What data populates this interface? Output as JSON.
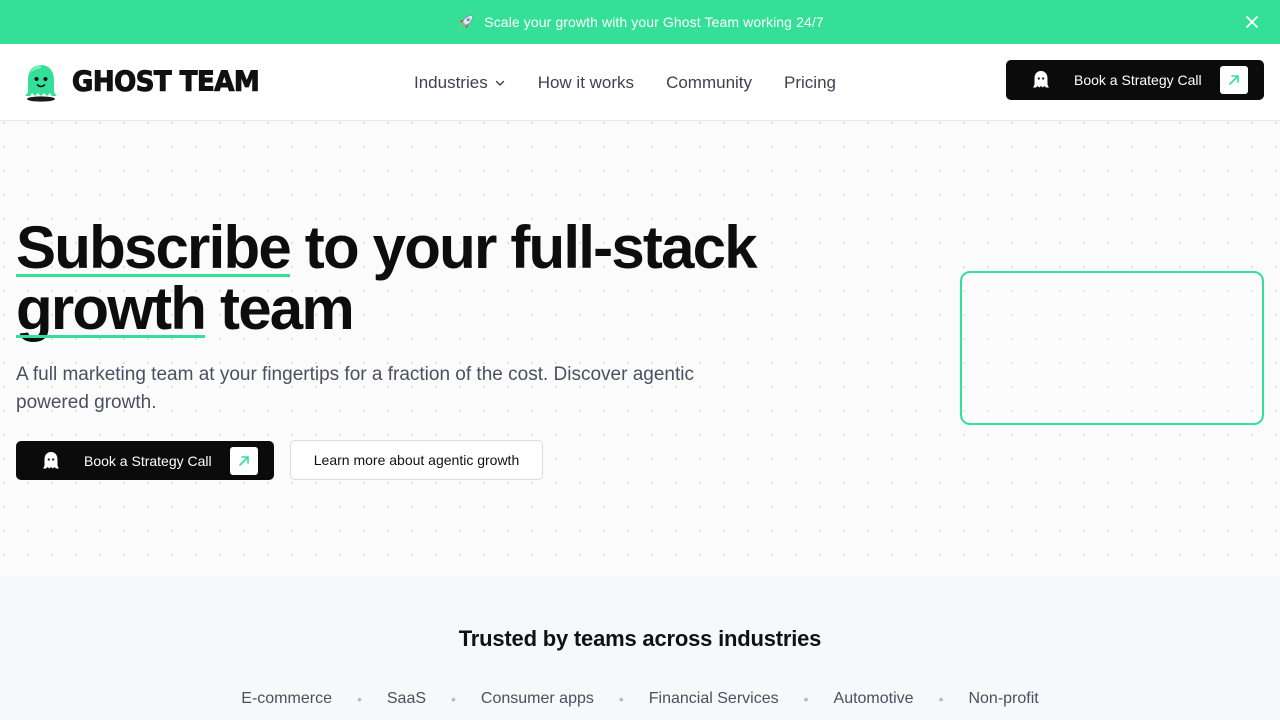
{
  "announcement": {
    "text": "Scale your growth with your Ghost Team working 24/7",
    "icon": "rocket-icon"
  },
  "header": {
    "logo_text": "GHOST TEAM",
    "nav": [
      {
        "label": "Industries",
        "has_dropdown": true
      },
      {
        "label": "How it works"
      },
      {
        "label": "Community"
      },
      {
        "label": "Pricing"
      }
    ],
    "cta_label": "Book a Strategy Call"
  },
  "hero": {
    "title_word1": "Subscribe",
    "title_mid": " to your full-stack",
    "title_word2": "growth",
    "title_end": " team",
    "subtitle": "A full marketing team at your fingertips for a fraction of the cost. Discover agentic powered growth.",
    "primary_cta": "Book a Strategy Call",
    "secondary_cta": "Learn more about agentic growth"
  },
  "trusted": {
    "title": "Trusted by teams across industries",
    "industries": [
      "E-commerce",
      "SaaS",
      "Consumer apps",
      "Financial Services",
      "Automotive",
      "Non-profit"
    ]
  },
  "colors": {
    "accent": "#34e097",
    "dark": "#0b0b0b",
    "text_muted": "#4a5060"
  }
}
